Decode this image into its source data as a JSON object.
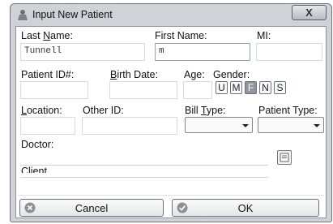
{
  "window": {
    "title": "Input New Patient",
    "close_glyph": "X"
  },
  "labels": {
    "last_name_pre": "Last ",
    "last_name_key": "N",
    "last_name_post": "ame:",
    "first_name": "First Name:",
    "mi": "MI:",
    "patient_id": "Patient ID#:",
    "birth_date_key": "B",
    "birth_date_post": "irth Date:",
    "age": "Age:",
    "gender": "Gender:",
    "location_key": "L",
    "location_post": "ocation:",
    "other_id": "Other ID:",
    "bill_type_pre": "Bill ",
    "bill_type_key": "T",
    "bill_type_post": "ype:",
    "patient_type": "Patient Type:",
    "doctor_key": "D",
    "doctor_post": "octor:",
    "client": "Client"
  },
  "fields": {
    "last_name": "Tunnell",
    "first_name": "m",
    "mi": "",
    "patient_id": "",
    "birth_date": "",
    "age": "",
    "location": "",
    "other_id": "",
    "bill_type": "",
    "patient_type": "",
    "doctor": "",
    "client": ""
  },
  "gender_options": [
    "U",
    "M",
    "F",
    "N",
    "S"
  ],
  "gender_selected": "F",
  "buttons": {
    "cancel": "Cancel",
    "ok": "OK"
  },
  "icons": {
    "window": "patient-icon",
    "notes": "notes-icon",
    "cancel": "cancel-icon",
    "ok": "ok-icon"
  }
}
